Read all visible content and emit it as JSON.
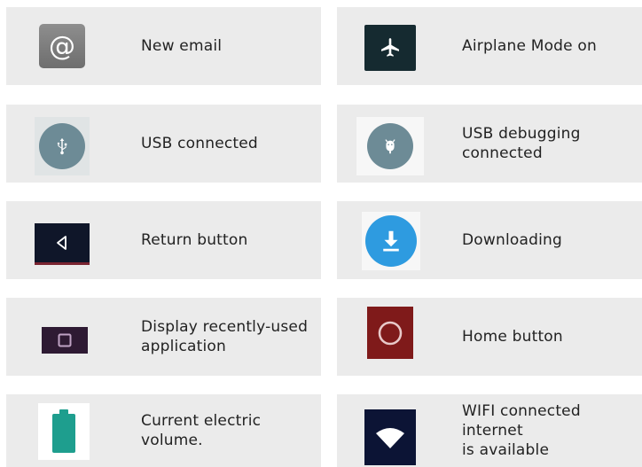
{
  "items": [
    {
      "label": "New email",
      "icon": "at-sign-icon"
    },
    {
      "label": "Airplane Mode on",
      "icon": "airplane-icon"
    },
    {
      "label": "USB connected",
      "icon": "usb-icon"
    },
    {
      "label": "USB debugging\nconnected",
      "icon": "android-debug-icon"
    },
    {
      "label": "Return button",
      "icon": "back-triangle-icon"
    },
    {
      "label": "Downloading",
      "icon": "download-icon"
    },
    {
      "label": "Display recently-used\napplication",
      "icon": "recent-apps-icon"
    },
    {
      "label": "Home button",
      "icon": "home-circle-icon"
    },
    {
      "label": "Current electric\nvolume.",
      "icon": "battery-icon"
    },
    {
      "label": "WIFI connected internet\nis available",
      "icon": "wifi-icon"
    }
  ],
  "email_glyph": "@",
  "colors": {
    "card_bg": "#ebebeb",
    "usb_blue_grey": "#6d8b96",
    "download_blue": "#2e9be0",
    "battery_teal": "#1e9e8e",
    "home_red": "#7f1a1a"
  }
}
